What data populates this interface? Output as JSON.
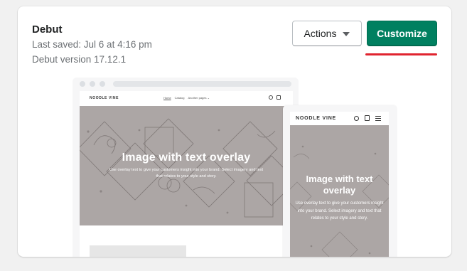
{
  "theme": {
    "name": "Debut",
    "last_saved": "Last saved: Jul 6 at 4:16 pm",
    "version": "Debut version 17.12.1"
  },
  "buttons": {
    "actions_label": "Actions",
    "customize_label": "Customize"
  },
  "preview": {
    "store_name": "NOODLE VINE",
    "nav": [
      "Home",
      "Catalog",
      "Another pages ⌄"
    ],
    "hero_title": "Image with text overlay",
    "hero_body": "Use overlay text to give your customers insight into your brand. Select imagery and text that relates to your style and story."
  },
  "colors": {
    "primary": "#008060",
    "highlight": "#e0242f",
    "hero_bg": "#aca6a5"
  }
}
